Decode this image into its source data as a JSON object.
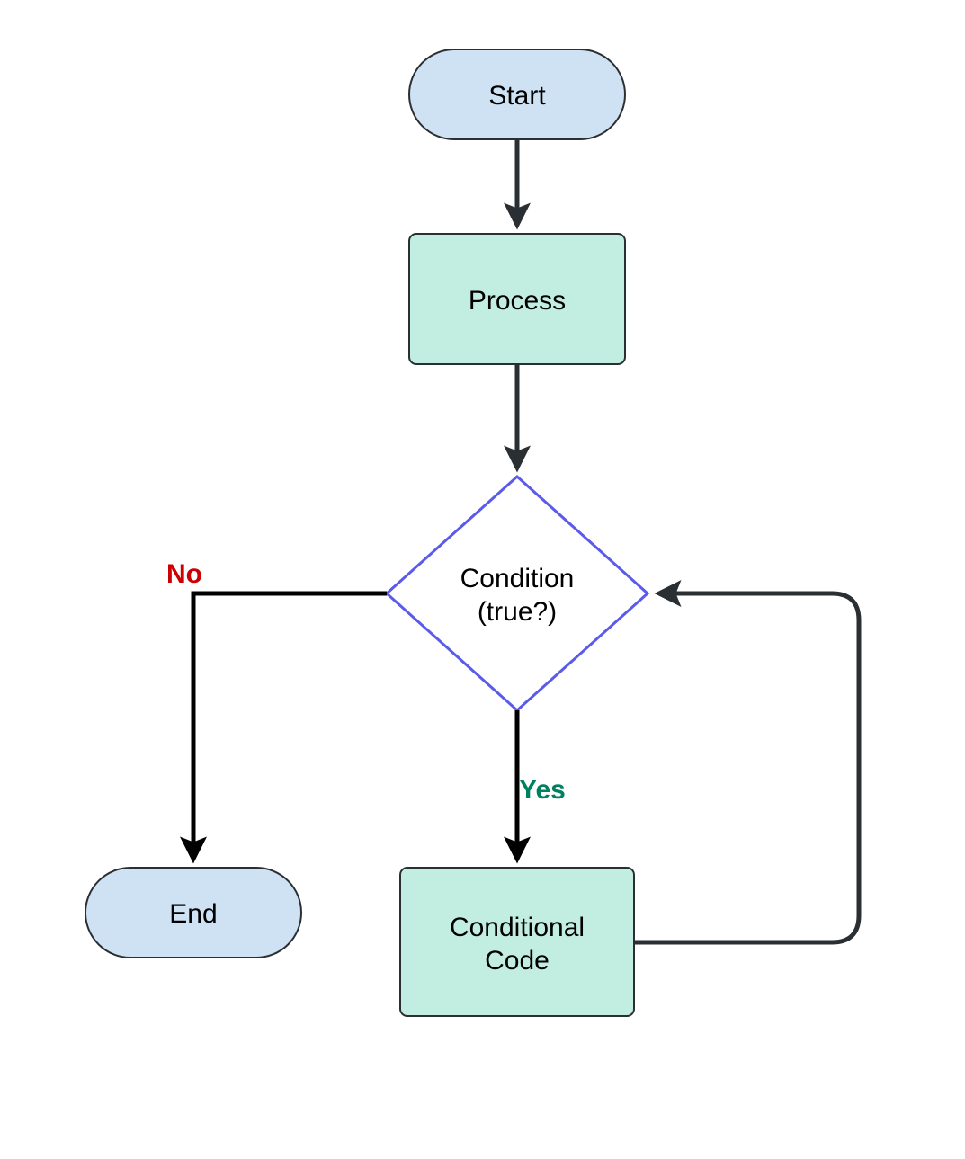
{
  "nodes": {
    "start": {
      "label": "Start"
    },
    "process": {
      "label": "Process"
    },
    "condition": {
      "line1": "Condition",
      "line2": "(true?)"
    },
    "conditional": {
      "line1": "Conditional",
      "line2": "Code"
    },
    "end": {
      "label": "End"
    }
  },
  "edges": {
    "no": {
      "label": "No",
      "color": "#cc0000"
    },
    "yes": {
      "label": "Yes",
      "color": "#008060"
    }
  },
  "colors": {
    "terminator": "#cfe2f3",
    "process": "#c2eee1",
    "decision_stroke": "#5b5beb",
    "arrow": "#2a2f33"
  }
}
